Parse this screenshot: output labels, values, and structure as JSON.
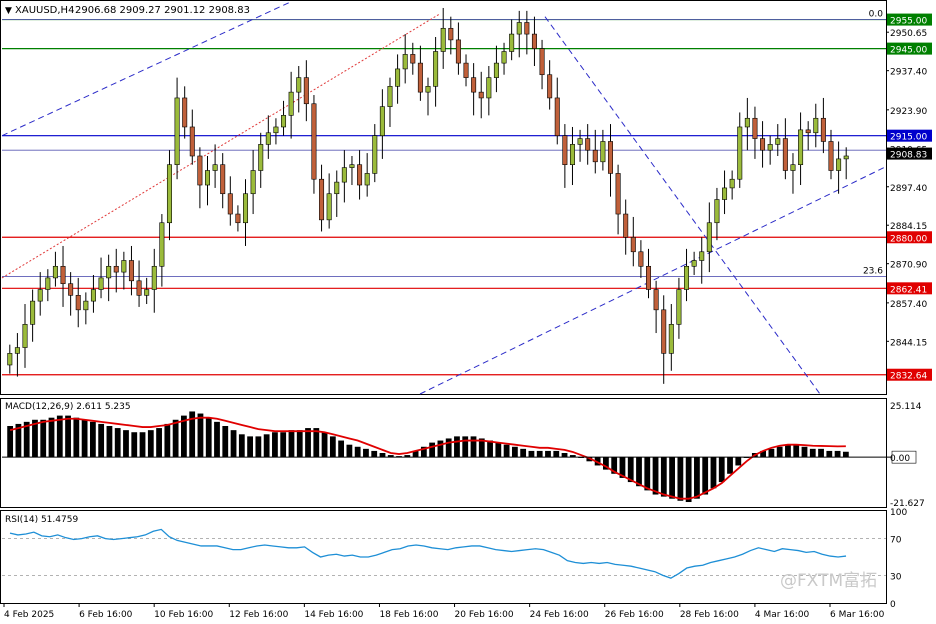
{
  "header": {
    "symbol": "XAUUSD,H4",
    "ohlc": "2906.68 2909.27 2901.12 2908.83"
  },
  "watermark": "@FXTM富拓",
  "colors": {
    "bull": "#9bbb3b",
    "bear": "#c0603a",
    "red_line": "#e00000",
    "green_line": "#008000",
    "blue_line": "#0000cc",
    "rsi": "#1e8fd6",
    "macd_signal": "#e00000"
  },
  "chart_data": [
    {
      "type": "candlestick",
      "title": "XAUUSD,H4",
      "y_ticks": [
        2950.65,
        2937.4,
        2923.9,
        2910.65,
        2897.4,
        2884.15,
        2870.9,
        2857.4,
        2844.15
      ],
      "ylim": [
        2826.0,
        2961.4
      ],
      "x_labels": [
        "4 Feb 2025",
        "6 Feb 16:00",
        "10 Feb 16:00",
        "12 Feb 16:00",
        "14 Feb 16:00",
        "18 Feb 16:00",
        "20 Feb 16:00",
        "24 Feb 16:00",
        "26 Feb 16:00",
        "28 Feb 16:00",
        "4 Mar 16:00",
        "6 Mar 16:00"
      ],
      "price_labels": [
        {
          "text": "2955.00",
          "value": 2955.0,
          "kind": "green"
        },
        {
          "text": "2945.00",
          "value": 2945.0,
          "kind": "green"
        },
        {
          "text": "2915.00",
          "value": 2915.0,
          "kind": "blue"
        },
        {
          "text": "2908.83",
          "value": 2908.83,
          "kind": "current"
        },
        {
          "text": "2880.00",
          "value": 2880.0,
          "kind": "red"
        },
        {
          "text": "2862.41",
          "value": 2862.41,
          "kind": "red"
        },
        {
          "text": "2832.64",
          "value": 2832.64,
          "kind": "red"
        }
      ],
      "fib_levels": [
        {
          "label": "0.0",
          "value": 2955.0
        },
        {
          "label": "23.6",
          "value": 2866.5
        }
      ],
      "fib_extra_line": 2910.0,
      "close_series": [
        2840,
        2842,
        2850,
        2858,
        2862,
        2866,
        2870,
        2864,
        2860,
        2855,
        2858,
        2862,
        2866,
        2870,
        2868,
        2872,
        2865,
        2860,
        2862,
        2870,
        2885,
        2905,
        2928,
        2918,
        2908,
        2898,
        2903,
        2905,
        2895,
        2888,
        2885,
        2895,
        2903,
        2912,
        2916,
        2918,
        2922,
        2930,
        2935,
        2926,
        2900,
        2886,
        2895,
        2899,
        2904,
        2905,
        2898,
        2902,
        2915,
        2925,
        2932,
        2938,
        2943,
        2940,
        2930,
        2932,
        2944,
        2952,
        2948,
        2940,
        2935,
        2930,
        2928,
        2935,
        2940,
        2944,
        2950,
        2954,
        2950,
        2945,
        2936,
        2928,
        2915,
        2905,
        2912,
        2914,
        2910,
        2906,
        2913,
        2902,
        2888,
        2880,
        2875,
        2870,
        2862,
        2855,
        2840,
        2850,
        2862,
        2870,
        2872,
        2875,
        2885,
        2893,
        2897,
        2900,
        2918,
        2921,
        2914,
        2910,
        2912,
        2914,
        2903,
        2905,
        2917,
        2916,
        2921,
        2913,
        2903,
        2907,
        2908
      ],
      "wick_extremes": {
        "high": 2958.0,
        "low": 2829.5
      },
      "current_price": 2908.83
    },
    {
      "type": "bar",
      "title": "MACD(12,26,9) 2.611 5.235",
      "series": [
        {
          "name": "MACD",
          "role": "histogram",
          "latest": 2.611
        },
        {
          "name": "Signal",
          "role": "line",
          "latest": 5.235
        }
      ],
      "y_ticks": [
        25.114,
        0.0,
        -21.627
      ],
      "ylim": [
        -24.0,
        28.0
      ],
      "macd_values": [
        15,
        16,
        17,
        18,
        18,
        19,
        20,
        20,
        19,
        18,
        17,
        16,
        15,
        14,
        13,
        12,
        12,
        13,
        14,
        16,
        18,
        20,
        22,
        21,
        19,
        17,
        15,
        13,
        11,
        10,
        10,
        11,
        12,
        12,
        13,
        13,
        14,
        14,
        12,
        10,
        8,
        6,
        5,
        4,
        3,
        2,
        1,
        0.5,
        1,
        3,
        5,
        7,
        8,
        9,
        10,
        10,
        10,
        9,
        8,
        7,
        6,
        5,
        4,
        3,
        3,
        3,
        3,
        2,
        1,
        0,
        -2,
        -4,
        -6,
        -8,
        -10,
        -12,
        -14,
        -16,
        -18,
        -19,
        -20,
        -21,
        -21.6,
        -20,
        -18,
        -15,
        -12,
        -8,
        -4,
        0,
        2,
        3,
        4,
        5,
        6,
        6,
        5,
        4,
        4,
        3,
        3,
        2.6
      ],
      "signal_values": [
        13,
        14,
        15,
        16,
        17,
        17.5,
        18,
        18.5,
        18.5,
        18,
        17.5,
        17,
        16.5,
        16,
        15.5,
        15,
        14.5,
        14.5,
        15,
        15.5,
        16.5,
        17.5,
        18.5,
        19,
        19,
        18.5,
        17.5,
        16.5,
        15.5,
        14.5,
        13.5,
        13,
        12.5,
        12.5,
        12.5,
        12.5,
        12.5,
        12.5,
        12,
        11,
        10,
        9,
        8,
        6.5,
        5,
        3.5,
        2,
        1.5,
        2,
        3,
        4,
        5,
        6,
        7,
        7.5,
        8,
        8,
        8,
        7.5,
        7,
        6.5,
        6,
        5.5,
        5,
        4.5,
        4.5,
        4,
        3.5,
        2.5,
        1,
        -0.5,
        -2.5,
        -4.5,
        -7,
        -9,
        -11,
        -13,
        -15,
        -16.5,
        -18,
        -19,
        -20,
        -20,
        -19,
        -17,
        -15,
        -12.5,
        -9,
        -5.5,
        -2,
        1,
        3,
        4.5,
        5.5,
        6,
        6,
        5.8,
        5.5,
        5.4,
        5.3,
        5.2,
        5.235
      ]
    },
    {
      "type": "line",
      "title": "RSI(14) 51.4759",
      "series": [
        {
          "name": "RSI",
          "latest": 51.4759
        }
      ],
      "y_ticks": [
        100,
        70,
        30,
        0
      ],
      "levels": [
        70,
        30
      ],
      "ylim": [
        0,
        100
      ],
      "values": [
        76,
        74,
        75,
        77,
        73,
        72,
        74,
        71,
        69,
        70,
        72,
        73,
        70,
        69,
        70,
        71,
        72,
        74,
        78,
        80,
        72,
        68,
        66,
        64,
        62,
        62,
        62,
        60,
        58,
        58,
        60,
        62,
        63,
        62,
        61,
        60,
        60,
        61,
        55,
        50,
        52,
        53,
        51,
        52,
        50,
        50,
        52,
        55,
        58,
        59,
        62,
        63,
        62,
        60,
        59,
        58,
        60,
        61,
        62,
        62,
        60,
        58,
        57,
        56,
        57,
        58,
        59,
        58,
        55,
        52,
        46,
        44,
        43,
        44,
        43,
        44,
        42,
        41,
        40,
        38,
        36,
        34,
        30,
        27,
        32,
        38,
        40,
        41,
        44,
        46,
        48,
        50,
        53,
        57,
        60,
        58,
        56,
        59,
        58,
        57,
        55,
        56,
        53,
        51,
        50,
        51
      ]
    }
  ]
}
